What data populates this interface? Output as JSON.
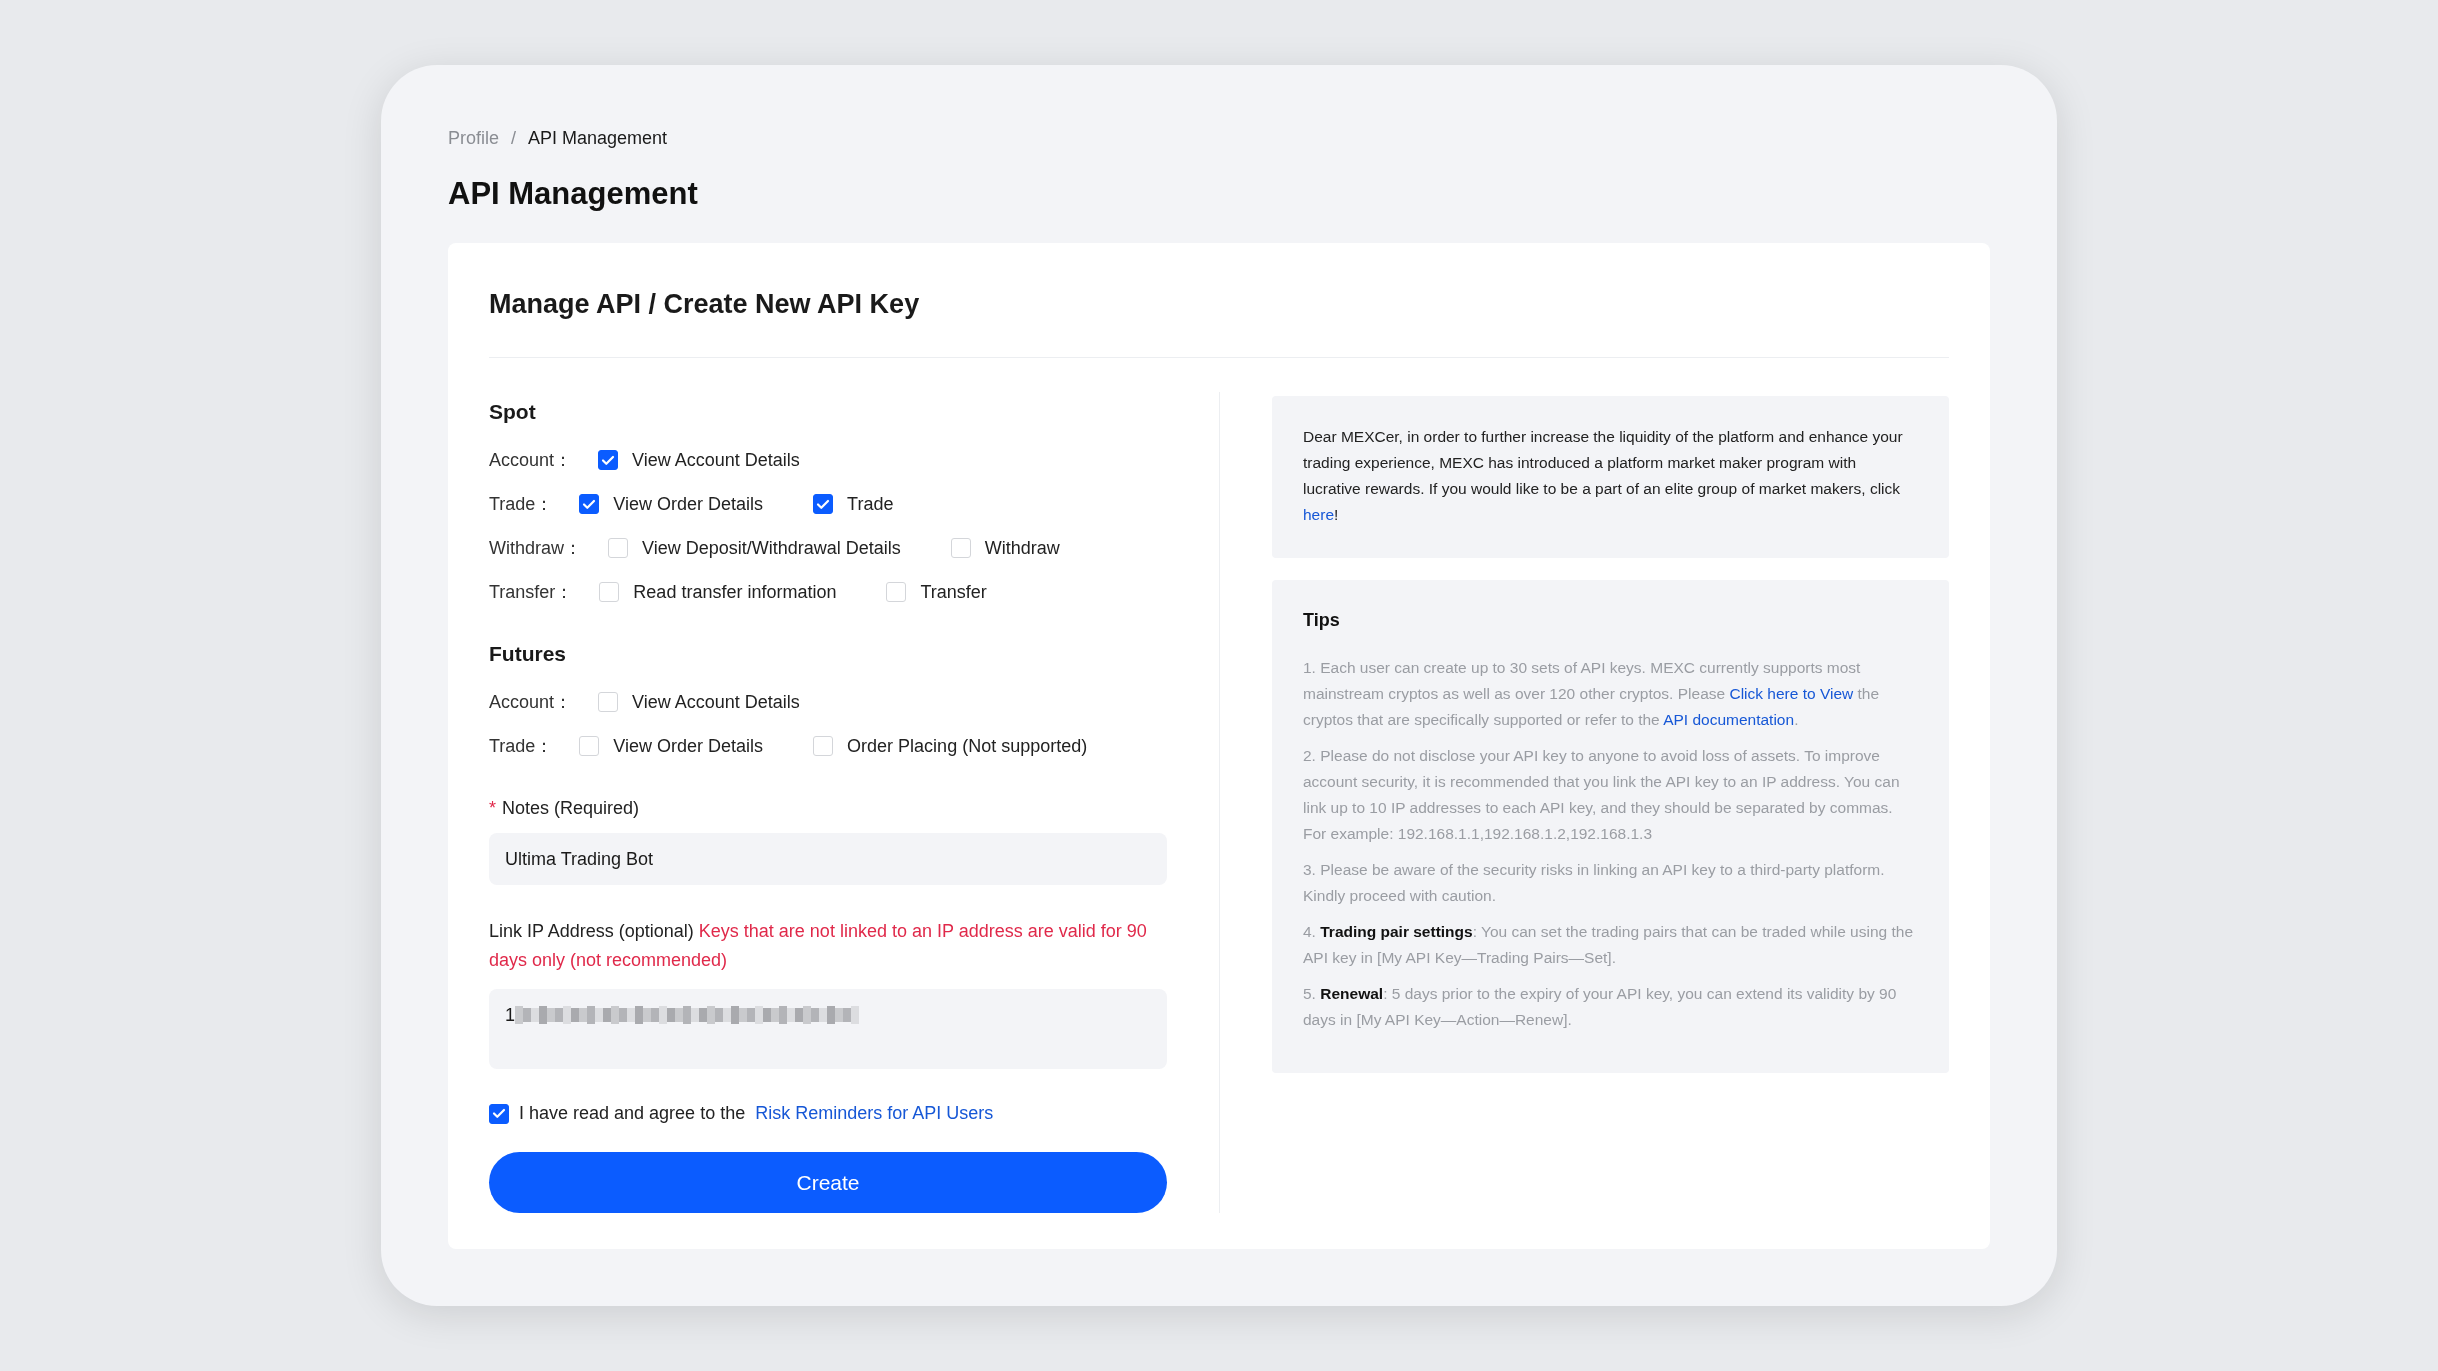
{
  "breadcrumb_separator": "/",
  "breadcrumb": [
    {
      "label": "Profile",
      "selected": false
    },
    {
      "label": "API Management",
      "selected": true
    }
  ],
  "page_title": "API Management",
  "card_title": "Manage API / Create New API Key",
  "sections": [
    {
      "title": "Spot",
      "rows": [
        {
          "label": "Account：",
          "options": [
            {
              "label": "View Account Details",
              "checked": true
            }
          ]
        },
        {
          "label": "Trade：",
          "options": [
            {
              "label": "View Order Details",
              "checked": true
            },
            {
              "label": "Trade",
              "checked": true
            }
          ]
        },
        {
          "label": "Withdraw：",
          "options": [
            {
              "label": "View Deposit/Withdrawal Details",
              "checked": false
            },
            {
              "label": "Withdraw",
              "checked": false
            }
          ]
        },
        {
          "label": "Transfer：",
          "options": [
            {
              "label": "Read transfer information",
              "checked": false
            },
            {
              "label": "Transfer",
              "checked": false
            }
          ]
        }
      ]
    },
    {
      "title": "Futures",
      "rows": [
        {
          "label": "Account：",
          "options": [
            {
              "label": "View Account Details",
              "checked": false
            }
          ]
        },
        {
          "label": "Trade：",
          "options": [
            {
              "label": "View Order Details",
              "checked": false
            },
            {
              "label": "Order Placing (Not supported)",
              "checked": false
            }
          ]
        }
      ]
    }
  ],
  "notes": {
    "required_mark": "*",
    "label": "Notes (Required)",
    "value": "Ultima Trading Bot"
  },
  "ip": {
    "label": "Link IP Address (optional)",
    "warning": "Keys that are not linked to an IP address are valid for 90 days only (not recommended)",
    "value": "1",
    "redacted": true
  },
  "agree": {
    "checked": true,
    "text": "I have read and agree to the",
    "link": "Risk Reminders for API Users"
  },
  "create_button": "Create",
  "promo": [
    {
      "kind": "text",
      "text": "Dear MEXCer, in order to further increase the liquidity of the platform and enhance your trading experience, MEXC has introduced a platform market maker program with lucrative rewards. If you would like to be a part of an elite group of market makers, click "
    },
    {
      "kind": "link",
      "text": "here"
    },
    {
      "kind": "text",
      "text": "!"
    }
  ],
  "tips": {
    "title": "Tips",
    "items": [
      [
        {
          "kind": "text",
          "text": "1. Each user can create up to 30 sets of API keys. MEXC currently supports most mainstream cryptos as well as over 120 other cryptos. Please "
        },
        {
          "kind": "link",
          "text": "Click here to View"
        },
        {
          "kind": "text",
          "text": " the cryptos that are specifically supported or refer to the "
        },
        {
          "kind": "link",
          "text": "API documentation"
        },
        {
          "kind": "text",
          "text": "."
        }
      ],
      [
        {
          "kind": "text",
          "text": "2. Please do not disclose your API key to anyone to avoid loss of assets. To improve account security, it is recommended that you link the API key to an IP address. You can link up to 10 IP addresses to each API key, and they should be separated by commas. For example: 192.168.1.1,192.168.1.2,192.168.1.3"
        }
      ],
      [
        {
          "kind": "text",
          "text": "3. Please be aware of the security risks in linking an API key to a third-party platform. Kindly proceed with caution."
        }
      ],
      [
        {
          "kind": "text",
          "text": "4. **Trading pair settings**: You can set the trading pairs that can be traded while using the API key in [My API Key—Trading Pairs—Set]."
        }
      ],
      [
        {
          "kind": "text",
          "text": "5. **Renewal**: 5 days prior to the expiry of your API key, you can extend its validity by 90 days in [My API Key—Action—Renew]."
        }
      ]
    ]
  }
}
